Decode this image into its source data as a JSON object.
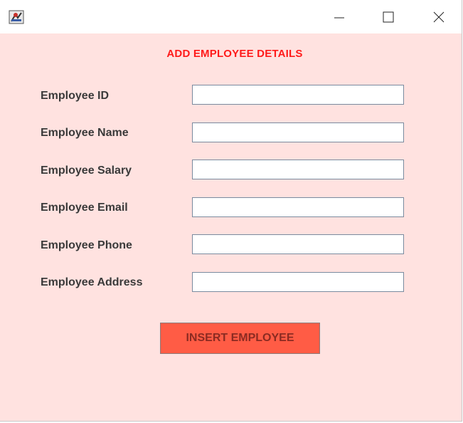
{
  "window": {
    "title": "",
    "icon": "java-app-icon"
  },
  "titlebar": {
    "minimize_icon": "minimize-icon",
    "maximize_icon": "maximize-icon",
    "close_icon": "close-icon"
  },
  "form": {
    "heading": "ADD EMPLOYEE DETAILS",
    "fields": [
      {
        "label": "Employee ID",
        "value": "",
        "placeholder": ""
      },
      {
        "label": "Employee Name",
        "value": "",
        "placeholder": ""
      },
      {
        "label": "Employee Salary",
        "value": "",
        "placeholder": ""
      },
      {
        "label": "Employee Email",
        "value": "",
        "placeholder": ""
      },
      {
        "label": "Employee Phone",
        "value": "",
        "placeholder": ""
      },
      {
        "label": "Employee Address",
        "value": "",
        "placeholder": ""
      }
    ],
    "submit_label": "INSERT EMPLOYEE"
  },
  "colors": {
    "background": "#ffe2e0",
    "heading": "#ff1a1a",
    "button_fill": "#ff5c45",
    "button_text": "#8b2b22"
  }
}
